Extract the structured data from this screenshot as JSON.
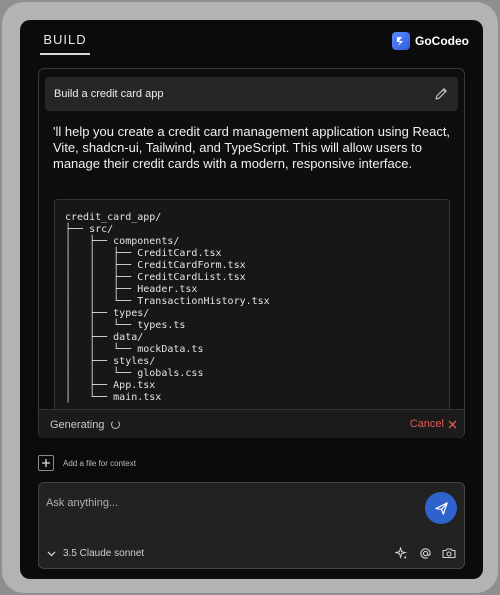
{
  "header": {
    "tab_label": "BUILD",
    "brand_name": "GoCodeo"
  },
  "chat": {
    "prompt": "Build a credit card app",
    "reply": "'ll help you create a credit card management application using React, Vite, shadcn-ui, Tailwind, and TypeScript. This will allow users to manage their credit cards with a modern, responsive interface.",
    "code_tree": "credit_card_app/\n├── src/\n│   ├── components/\n│   │   ├── CreditCard.tsx\n│   │   ├── CreditCardForm.tsx\n│   │   ├── CreditCardList.tsx\n│   │   ├── Header.tsx\n│   │   └── TransactionHistory.tsx\n│   ├── types/\n│   │   └── types.ts\n│   ├── data/\n│   │   └── mockData.ts\n│   ├── styles/\n│   │   └── globals.css\n│   ├── App.tsx\n│   └── main.tsx",
    "status_label": "Generating",
    "cancel_label": "Cancel"
  },
  "context": {
    "add_file_label": "Add a file for context"
  },
  "composer": {
    "placeholder": "Ask anything...",
    "model_name": "3.5 Claude sonnet"
  },
  "colors": {
    "accent": "#2f62cc",
    "cancel": "#e05a55",
    "background": "#0b0b0b"
  },
  "icons": [
    "gocodeo-logo-icon",
    "edit-pencil-icon",
    "spinner-icon",
    "close-x-icon",
    "plus-icon",
    "send-icon",
    "chevron-down-icon",
    "sparkle-icon",
    "at-mention-icon",
    "camera-icon"
  ]
}
